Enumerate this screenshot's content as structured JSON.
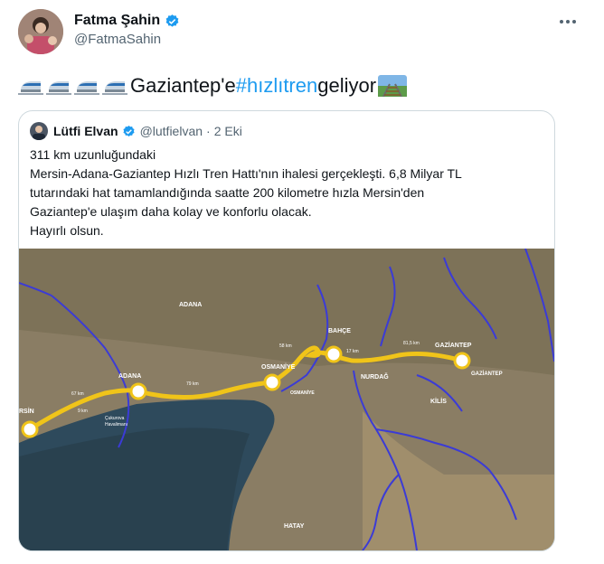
{
  "author": {
    "name": "Fatma Şahin",
    "handle": "@FatmaSahin"
  },
  "tweet": {
    "text_main": "Gaziantep'e ",
    "hashtag": "#hızlıtren",
    "text_after": " geliyor",
    "train_icon_count": 4
  },
  "quoted_tweet": {
    "name": "Lütfi Elvan",
    "handle": "@lutfielvan",
    "separator": "·",
    "date": "2 Eki",
    "lines": [
      "311 km uzunluğundaki",
      "Mersin-Adana-Gaziantep Hızlı Tren Hattı'nın ihalesi gerçekleşti. 6,8 Milyar TL",
      "tutarındaki hat tamamlandığında saatte 200 kilometre hızla Mersin'den",
      "Gaziantep'e ulaşım daha kolay ve konforlu olacak.",
      "Hayırlı olsun."
    ]
  },
  "map": {
    "region_labels": [
      "ADANA",
      "OSMANİYE",
      "KİLİS",
      "HATAY",
      "GAZİANTEP"
    ],
    "station_labels": [
      "RSİN",
      "ADANA",
      "OSMANİYE",
      "BAHÇE",
      "GAZİANTEP",
      "NURDAĞ"
    ],
    "other_labels": [
      "Çukurova",
      "Havalimanı"
    ],
    "distance_labels": [
      "67 km",
      "9 km",
      "79 km",
      "58 km",
      "17 km",
      "81,5 km"
    ],
    "colors": {
      "route": "#f0c419",
      "rivers": "#3b3bd6",
      "sea": "#2e4a5c",
      "land": "#8a7d64",
      "verified": "#1d9bf0",
      "link": "#1d9bf0"
    }
  }
}
